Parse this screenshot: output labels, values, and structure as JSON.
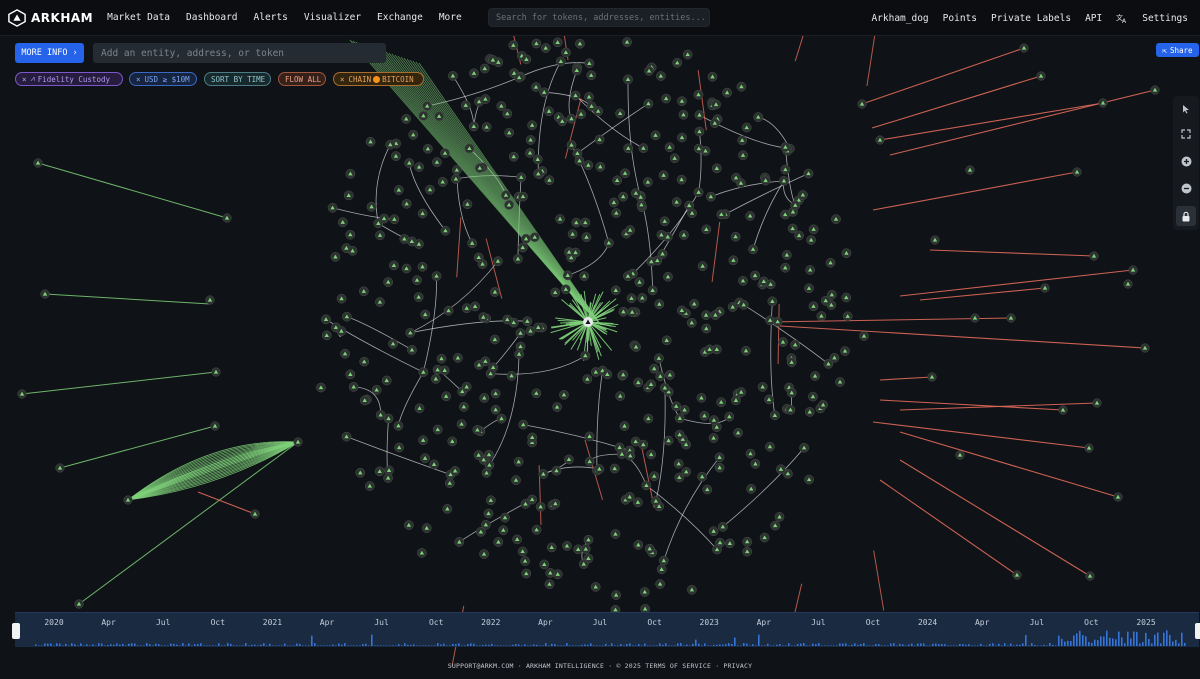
{
  "app": {
    "name": "ARKHAM"
  },
  "nav": {
    "left": [
      "Market Data",
      "Dashboard",
      "Alerts",
      "Visualizer",
      "Exchange",
      "More"
    ],
    "search_placeholder": "Search for tokens, addresses, entities...",
    "right": [
      "Arkham_dog",
      "Points",
      "Private Labels",
      "API"
    ],
    "settings": "Settings"
  },
  "toolbar": {
    "more_info": "MORE INFO",
    "entity_placeholder": "Add an entity, address, or token",
    "share": "Share"
  },
  "filters": {
    "entity": "Fidelity Custody",
    "usd": "USD ≥ $10M",
    "sort": "SORT BY TIME",
    "flow": "FLOW ALL",
    "chain_label": "CHAIN",
    "chain_value": "BITCOIN"
  },
  "colors": {
    "accent_blue": "#2563eb",
    "inflow_green": "#7fd17a",
    "outflow_red": "#e06a5a",
    "edge_white": "#d7d9de",
    "node_fill": "#2c3230"
  },
  "side_icons": [
    "cursor-icon",
    "fullscreen-icon",
    "zoom-in-icon",
    "zoom-out-icon",
    "lock-icon"
  ],
  "timeline": {
    "labels": [
      "2020",
      "Apr",
      "Jul",
      "Oct",
      "2021",
      "Apr",
      "Jul",
      "Oct",
      "2022",
      "Apr",
      "Jul",
      "Oct",
      "2023",
      "Apr",
      "Jul",
      "Oct",
      "2024",
      "Apr",
      "Jul",
      "Oct",
      "2025"
    ]
  },
  "footer": {
    "email": "SUPPORT@ARKM.COM",
    "company": "ARKHAM INTELLIGENCE",
    "copyright": "© 2025",
    "terms": "TERMS OF SERVICE",
    "privacy": "PRIVACY"
  }
}
